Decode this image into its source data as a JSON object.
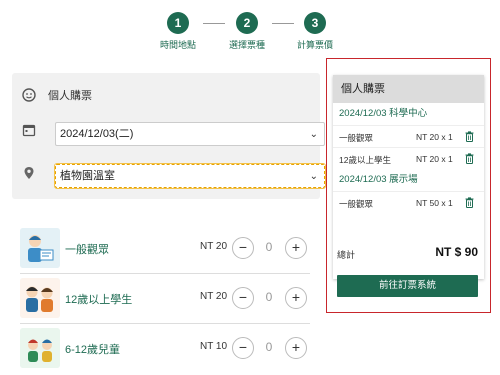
{
  "stepper": {
    "steps": [
      {
        "number": "1",
        "label": "時間地點"
      },
      {
        "number": "2",
        "label": "選擇票種"
      },
      {
        "number": "3",
        "label": "計算票價"
      }
    ]
  },
  "form": {
    "ticket_type_label": "個人購票",
    "date_value": "2024/12/03(二)",
    "venue_value": "植物園溫室"
  },
  "tickets": [
    {
      "name": "一般觀眾",
      "price": "NT 20",
      "quantity": "0"
    },
    {
      "name": "12歲以上學生",
      "price": "NT 20",
      "quantity": "0"
    },
    {
      "name": "6-12歲兒童",
      "price": "NT 10",
      "quantity": "0"
    }
  ],
  "summary": {
    "title": "個人購票",
    "sections": [
      {
        "heading": "2024/12/03 科學中心",
        "items": [
          {
            "name": "一般觀眾",
            "qty": "NT 20 x 1"
          },
          {
            "name": "12歲以上學生",
            "qty": "NT 20 x 1"
          }
        ]
      },
      {
        "heading": "2024/12/03 展示場",
        "items": [
          {
            "name": "一般觀眾",
            "qty": "NT 50 x 1"
          }
        ]
      }
    ],
    "total_label": "總計",
    "total_value": "NT $ 90",
    "checkout_label": "前往訂票系統"
  },
  "colors": {
    "brand": "#1e6b52",
    "highlight_border": "#c8262c",
    "focus_border": "#e8a200"
  },
  "icons": [
    "face-icon",
    "calendar-icon",
    "location-pin-icon",
    "chevron-down-icon",
    "trash-icon"
  ]
}
